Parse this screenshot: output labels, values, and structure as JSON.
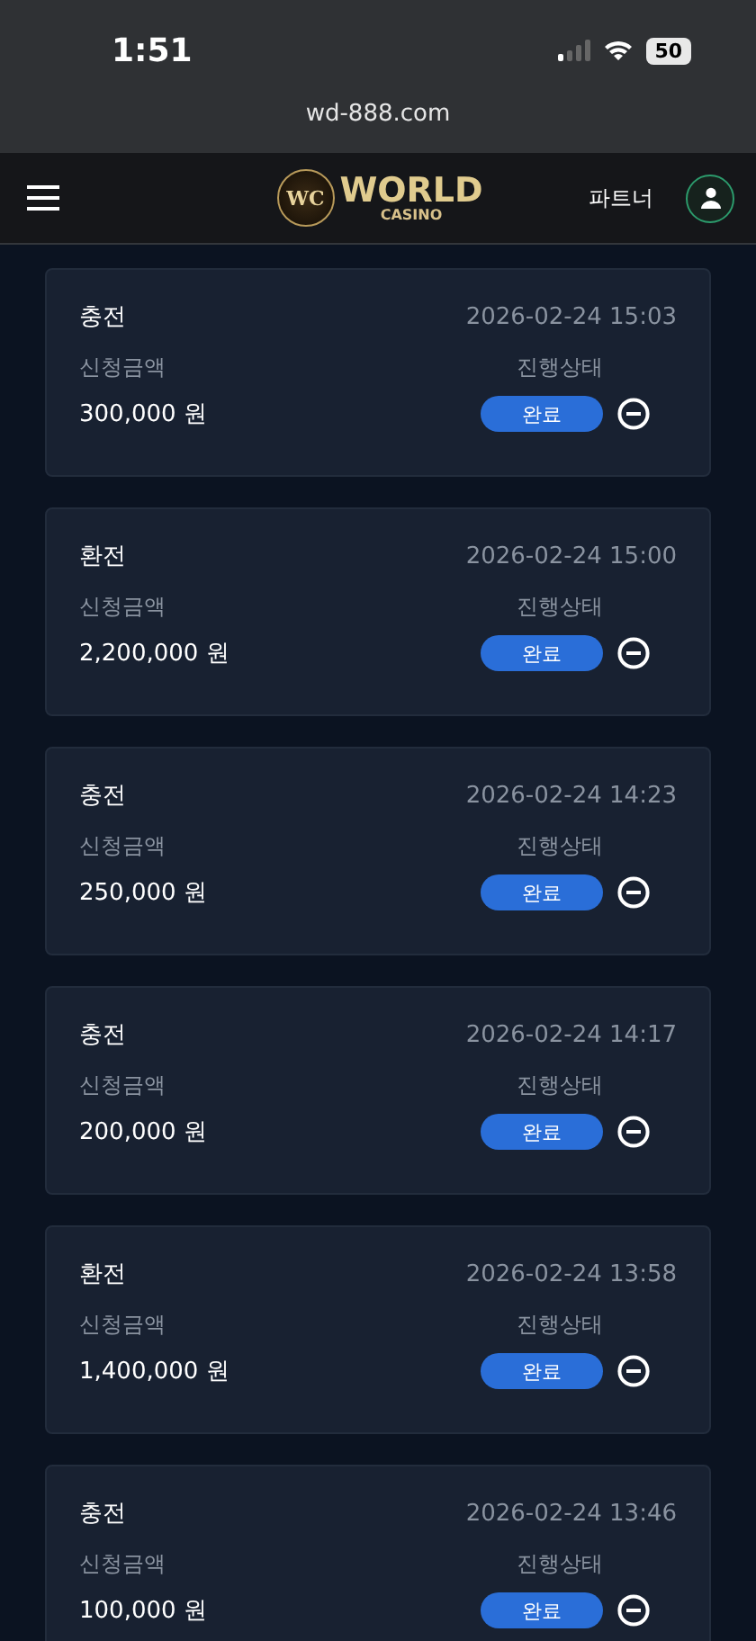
{
  "status_bar": {
    "time": "1:51",
    "battery": "50"
  },
  "url_bar": {
    "url": "wd-888.com"
  },
  "header": {
    "logo_mark": "WC",
    "logo_title": "WORLD",
    "logo_subtitle": "CASINO",
    "partner_link": "파트너"
  },
  "transactions": [
    {
      "type": "충전",
      "datetime": "2026-02-24 15:03",
      "amount_label": "신청금액",
      "amount": "300,000 원",
      "status_label": "진행상태",
      "status": "완료"
    },
    {
      "type": "환전",
      "datetime": "2026-02-24 15:00",
      "amount_label": "신청금액",
      "amount": "2,200,000 원",
      "status_label": "진행상태",
      "status": "완료"
    },
    {
      "type": "충전",
      "datetime": "2026-02-24 14:23",
      "amount_label": "신청금액",
      "amount": "250,000 원",
      "status_label": "진행상태",
      "status": "완료"
    },
    {
      "type": "충전",
      "datetime": "2026-02-24 14:17",
      "amount_label": "신청금액",
      "amount": "200,000 원",
      "status_label": "진행상태",
      "status": "완료"
    },
    {
      "type": "환전",
      "datetime": "2026-02-24 13:58",
      "amount_label": "신청금액",
      "amount": "1,400,000 원",
      "status_label": "진행상태",
      "status": "완료"
    },
    {
      "type": "충전",
      "datetime": "2026-02-24 13:46",
      "amount_label": "신청금액",
      "amount": "100,000 원",
      "status_label": "진행상태",
      "status": "완료"
    }
  ]
}
